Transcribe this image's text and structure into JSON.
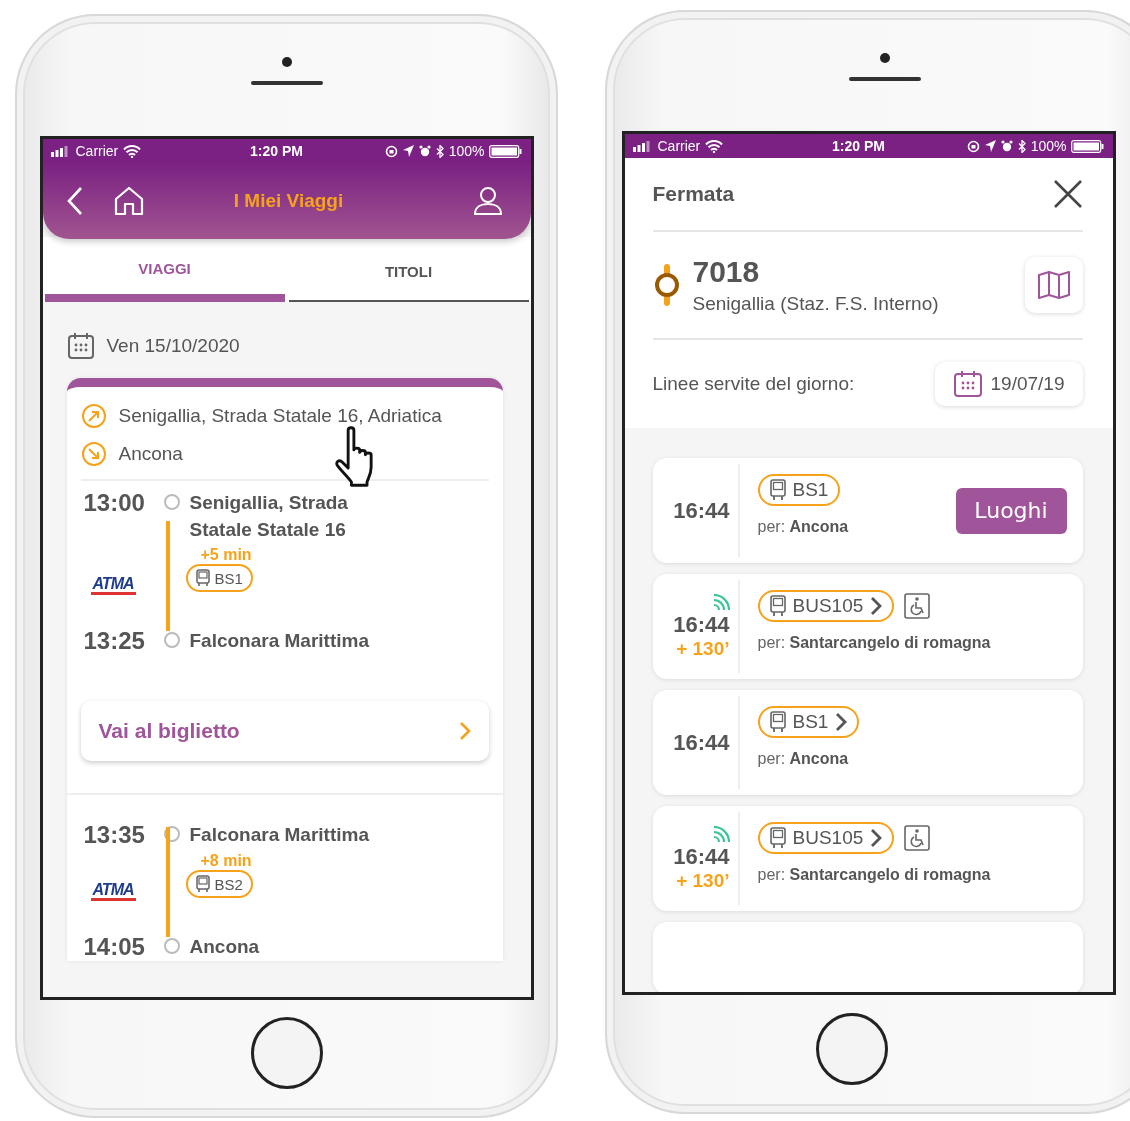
{
  "phones": [
    {
      "kind": "trips",
      "status_bar": {
        "carrier": "Carrier",
        "time": "1:20 PM",
        "battery": "100%"
      },
      "header": {
        "title": "I Miei Viaggi"
      },
      "tabs": [
        {
          "label": "VIAGGI",
          "selected": true
        },
        {
          "label": "TITOLI",
          "selected": false
        }
      ],
      "date": "Ven 15/10/2020",
      "sections": [
        {
          "from": "Senigallia, Strada Statale 16, Adriatica",
          "to": "Ancona",
          "leg": {
            "depart_time": "13:00",
            "depart_stop": "Senigallia, Strada Statale Statale 16",
            "delay": "+5 min",
            "line": "BS1",
            "operator": "ATMA",
            "arrive_time": "13:25",
            "arrive_stop": "Falconara Marittima"
          },
          "ticket_button": "Vai al biglietto"
        },
        {
          "leg": {
            "depart_time": "13:35",
            "depart_stop": "Falconara Marittima",
            "delay": "+8 min",
            "line": "BS2",
            "operator": "ATMA",
            "arrive_time": "14:05",
            "arrive_stop": "Ancona"
          }
        }
      ]
    },
    {
      "kind": "stop",
      "status_bar": {
        "carrier": "Carrier",
        "time": "1:20 PM",
        "battery": "100%"
      },
      "title": "Fermata",
      "stop": {
        "code": "7018",
        "name": "Senigallia (Staz. F.S. Interno)"
      },
      "lines_label": "Linee servite del giorno:",
      "date": "19/07/19",
      "departures": [
        {
          "time": "16:44",
          "realtime": false,
          "line": "BS1",
          "chevron": false,
          "accessible": false,
          "dest_label": "per:",
          "destination": "Ancona",
          "action": "Luoghi"
        },
        {
          "time": "16:44",
          "delay": "+ 130’",
          "realtime": true,
          "line": "BUS105",
          "chevron": true,
          "accessible": true,
          "dest_label": "per:",
          "destination": "Santarcangelo di romagna"
        },
        {
          "time": "16:44",
          "realtime": false,
          "line": "BS1",
          "chevron": true,
          "accessible": false,
          "dest_label": "per:",
          "destination": "Ancona"
        },
        {
          "time": "16:44",
          "delay": "+ 130’",
          "realtime": true,
          "line": "BUS105",
          "chevron": true,
          "accessible": true,
          "dest_label": "per:",
          "destination": "Santarcangelo di romagna"
        }
      ]
    }
  ]
}
